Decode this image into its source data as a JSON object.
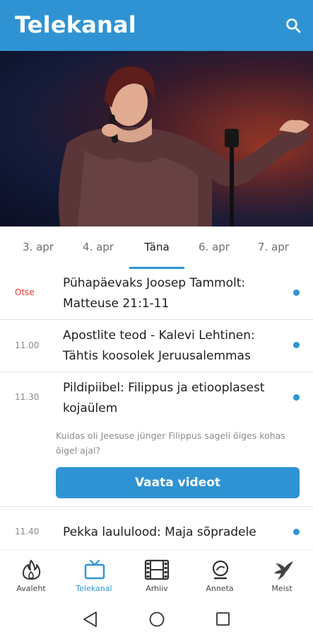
{
  "appbar": {
    "title": "Telekanal",
    "search_icon": "search-icon"
  },
  "tabs": [
    {
      "label": "3. apr",
      "active": false
    },
    {
      "label": "4. apr",
      "active": false
    },
    {
      "label": "Täna",
      "active": true
    },
    {
      "label": "6. apr",
      "active": false
    },
    {
      "label": "7. apr",
      "active": false
    }
  ],
  "schedule": [
    {
      "time": "Otse",
      "title": "Pühapäevaks Joosep Tammolt: Matteuse 21:1-11"
    },
    {
      "time": "11.00",
      "title": "Apostlite teod - Kalevi Lehtinen: Tähtis koosolek Jeruusalemmas"
    },
    {
      "time": "11.30",
      "title": "Pildipiibel: Filippus ja etiooplasest kojaülem",
      "description": "Kuidas oli Jeesuse jünger Filippus sageli õiges kohas õigel ajal?",
      "button": "Vaata videot"
    },
    {
      "time": "11.40",
      "title": "Pekka laululood: Maja sõpradele"
    }
  ],
  "bottom_nav": [
    {
      "label": "Avaleht",
      "icon": "flame-icon",
      "active": false
    },
    {
      "label": "Telekanal",
      "icon": "tv-icon",
      "active": true
    },
    {
      "label": "Arhiiv",
      "icon": "film-icon",
      "active": false
    },
    {
      "label": "Anneta",
      "icon": "donate-icon",
      "active": false
    },
    {
      "label": "Meist",
      "icon": "dove-icon",
      "active": false
    }
  ],
  "colors": {
    "accent": "#2f93d3",
    "live": "#e53935"
  }
}
